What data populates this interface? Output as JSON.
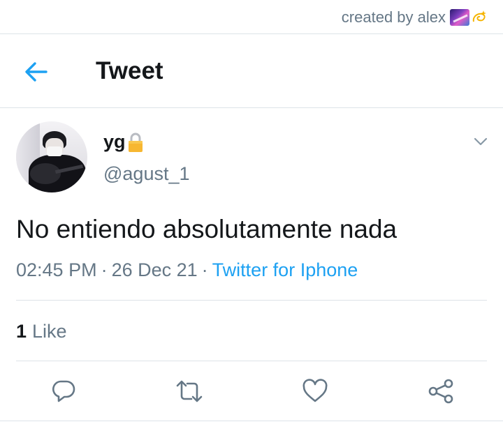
{
  "watermark": {
    "text": "created by alex",
    "emoji_icons": [
      "milky-way-icon",
      "dizzy-icon"
    ]
  },
  "header": {
    "back_icon": "arrow-left-icon",
    "title": "Tweet"
  },
  "tweet": {
    "author": {
      "display_name": "yg",
      "name_badge_icon": "lock-icon",
      "handle": "@agust_1"
    },
    "menu_icon": "chevron-down-icon",
    "text": "No entiendo absolutamente nada",
    "time": "02:45 PM",
    "date": "26 Dec 21",
    "separator": "·",
    "source": "Twitter for Iphone",
    "likes": {
      "count": "1",
      "label": "Like"
    }
  },
  "actions": [
    {
      "name": "reply",
      "icon": "reply-icon"
    },
    {
      "name": "retweet",
      "icon": "retweet-icon"
    },
    {
      "name": "like",
      "icon": "heart-icon"
    },
    {
      "name": "share",
      "icon": "share-icon"
    }
  ],
  "colors": {
    "accent": "#1da1f2",
    "secondary_text": "#657786",
    "primary_text": "#14171a",
    "divider": "#dde3e8"
  }
}
